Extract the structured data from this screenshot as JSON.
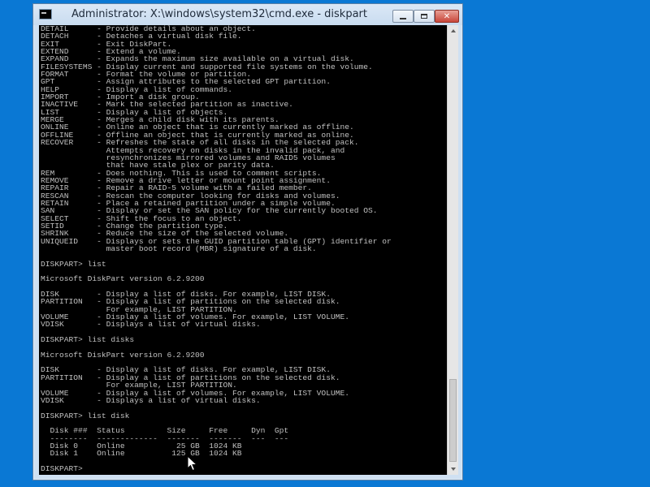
{
  "window": {
    "title": "Administrator: X:\\windows\\system32\\cmd.exe - diskpart"
  },
  "console": {
    "lines": [
      "DETAIL      - Provide details about an object.",
      "DETACH      - Detaches a virtual disk file.",
      "EXIT        - Exit DiskPart.",
      "EXTEND      - Extend a volume.",
      "EXPAND      - Expands the maximum size available on a virtual disk.",
      "FILESYSTEMS - Display current and supported file systems on the volume.",
      "FORMAT      - Format the volume or partition.",
      "GPT         - Assign attributes to the selected GPT partition.",
      "HELP        - Display a list of commands.",
      "IMPORT      - Import a disk group.",
      "INACTIVE    - Mark the selected partition as inactive.",
      "LIST        - Display a list of objects.",
      "MERGE       - Merges a child disk with its parents.",
      "ONLINE      - Online an object that is currently marked as offline.",
      "OFFLINE     - Offline an object that is currently marked as online.",
      "RECOVER     - Refreshes the state of all disks in the selected pack.",
      "              Attempts recovery on disks in the invalid pack, and",
      "              resynchronizes mirrored volumes and RAID5 volumes",
      "              that have stale plex or parity data.",
      "REM         - Does nothing. This is used to comment scripts.",
      "REMOVE      - Remove a drive letter or mount point assignment.",
      "REPAIR      - Repair a RAID-5 volume with a failed member.",
      "RESCAN      - Rescan the computer looking for disks and volumes.",
      "RETAIN      - Place a retained partition under a simple volume.",
      "SAN         - Display or set the SAN policy for the currently booted OS.",
      "SELECT      - Shift the focus to an object.",
      "SETID       - Change the partition type.",
      "SHRINK      - Reduce the size of the selected volume.",
      "UNIQUEID    - Displays or sets the GUID partition table (GPT) identifier or",
      "              master boot record (MBR) signature of a disk.",
      "",
      "DISKPART> list",
      "",
      "Microsoft DiskPart version 6.2.9200",
      "",
      "DISK        - Display a list of disks. For example, LIST DISK.",
      "PARTITION   - Display a list of partitions on the selected disk.",
      "              For example, LIST PARTITION.",
      "VOLUME      - Display a list of volumes. For example, LIST VOLUME.",
      "VDISK       - Displays a list of virtual disks.",
      "",
      "DISKPART> list disks",
      "",
      "Microsoft DiskPart version 6.2.9200",
      "",
      "DISK        - Display a list of disks. For example, LIST DISK.",
      "PARTITION   - Display a list of partitions on the selected disk.",
      "              For example, LIST PARTITION.",
      "VOLUME      - Display a list of volumes. For example, LIST VOLUME.",
      "VDISK       - Displays a list of virtual disks.",
      "",
      "DISKPART> list disk",
      "",
      "  Disk ###  Status         Size     Free     Dyn  Gpt",
      "  --------  -------------  -------  -------  ---  ---",
      "  Disk 0    Online           25 GB  1024 KB",
      "  Disk 1    Online          125 GB  1024 KB",
      "",
      "DISKPART> "
    ]
  }
}
